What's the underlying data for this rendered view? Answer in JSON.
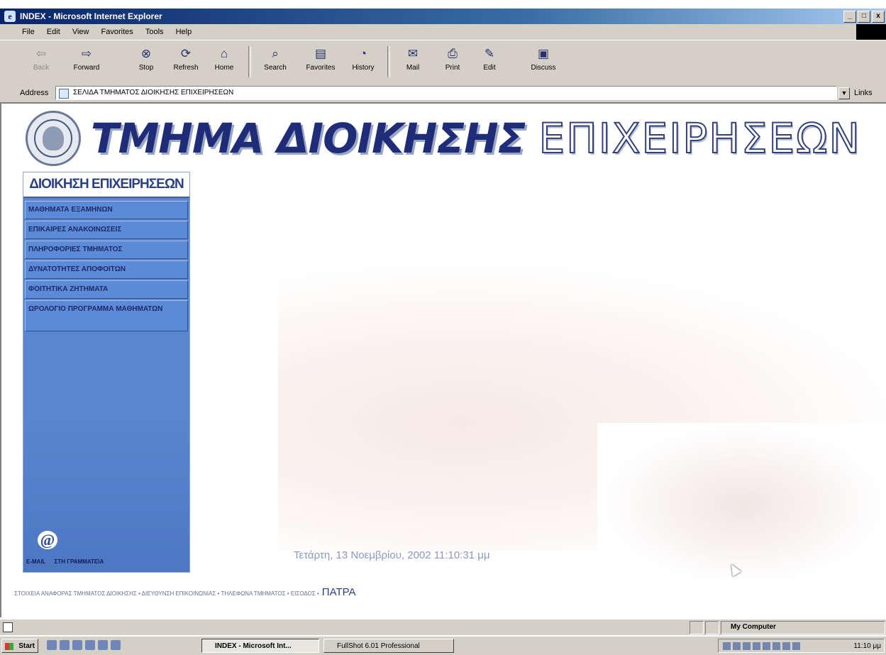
{
  "window": {
    "title": "INDEX - Microsoft Internet Explorer",
    "controls": [
      "_",
      "□",
      "x"
    ]
  },
  "menu": [
    "File",
    "Edit",
    "View",
    "Favorites",
    "Tools",
    "Help"
  ],
  "toolbar": {
    "back": "Back",
    "forward": "Forward",
    "stop": "Stop",
    "refresh": "Refresh",
    "home": "Home",
    "search": "Search",
    "favorites": "Favorites",
    "history": "History",
    "mail": "Mail",
    "print": "Print",
    "edit": "Edit",
    "discuss": "Discuss"
  },
  "address": {
    "label": "Address",
    "value": "ΣΕΛΙΔΑ ΤΜΗΜΑΤΟΣ ΔΙΟΙΚΗΣΗΣ ΕΠΙΧΕΙΡΗΣΕΩΝ",
    "links": "Links"
  },
  "page": {
    "banner_bold": "ΤΜΗΜΑ ΔΙΟΙΚΗΣΗΣ",
    "banner_outline": "ΕΠΙΧΕΙΡΗΣΕΩΝ",
    "sidebar_header": "ΔΙΟΙΚΗΣΗ ΕΠΙΧΕΙΡΗΣΕΩΝ",
    "menu_items": [
      "ΜΑΘΗΜΑΤΑ ΕΞΑΜΗΝΩΝ",
      "ΕΠΙΚΑΙΡΕΣ ΑΝΑΚΟΙΝΩΣΕΙΣ",
      "ΠΛΗΡΟΦΟΡΙΕΣ ΤΜΗΜΑΤΟΣ",
      "ΔΥΝΑΤΟΤΗΤΕΣ ΑΠΟΦΟΙΤΩΝ",
      "ΦΟΙΤΗΤΙΚΑ ΖΗΤΗΜΑΤΑ",
      "ΩΡΟΛΟΓΙΟ ΠΡΟΓΡΑΜΜΑ ΜΑΘΗΜΑΤΩΝ"
    ],
    "email_label": "E-MAIL",
    "email_text": "ΣΤΗ ΓΡΑΜΜΑΤΕΙΑ",
    "datetime": "Τετάρτη, 13 Νοεμβρίου, 2002 11:10:31 μμ",
    "footer_text": "ΣΤΟΙΧΕΙΑ ΑΝΑΦΟΡΑΣ ΤΜΗΜΑΤΟΣ ΔΙΟΙΚΗΣΗΣ • ΔΙΕΥΘΥΝΣΗ ΕΠΙΚΟΙΝΩΝΙΑΣ • ΤΗΛΕΦΩΝΑ ΤΜΗΜΑΤΟΣ • ΕΙΣΟΔΟΣ •",
    "footer_city": "ΠΑΤΡΑ"
  },
  "status": {
    "zone": "My Computer"
  },
  "taskbar": {
    "start": "Start",
    "tasks": [
      "INDEX - Microsoft Int...",
      "FullShot 6.01 Professional"
    ],
    "clock": "11:10 μμ"
  },
  "colors": {
    "titlebar": "#0a246a",
    "sidebar": "#5a86d0",
    "banner": "#1f2d78",
    "chrome": "#d4d0c8"
  },
  "icons": {
    "back": "arrow-left-icon",
    "forward": "arrow-right-icon",
    "stop": "stop-icon",
    "refresh": "refresh-icon",
    "home": "home-icon",
    "search": "search-icon",
    "favorites": "favorites-icon",
    "history": "history-icon",
    "mail": "mail-icon",
    "print": "printer-icon",
    "edit": "edit-icon",
    "discuss": "discuss-icon"
  }
}
